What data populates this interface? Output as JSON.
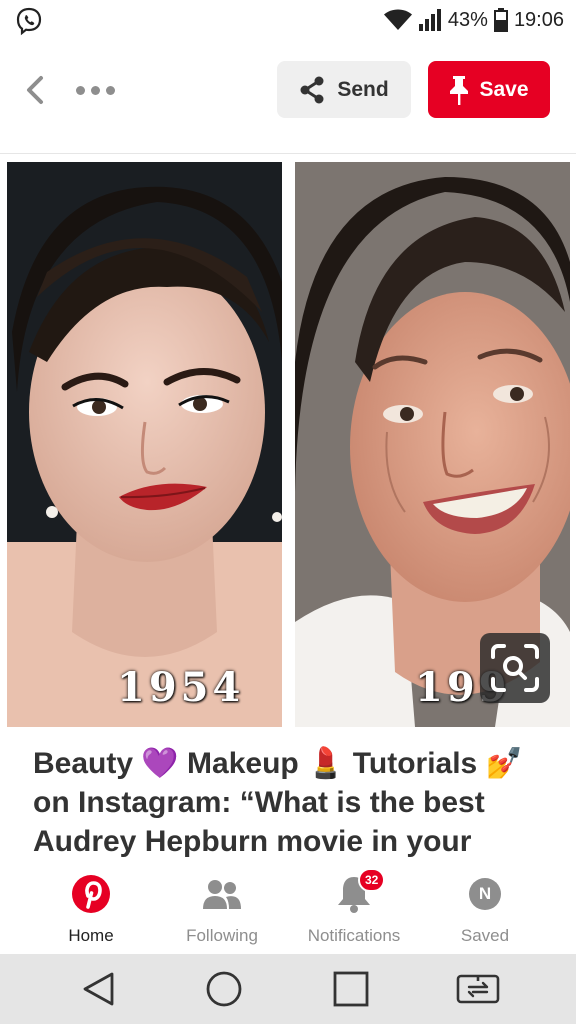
{
  "status_bar": {
    "battery_percent": "43%",
    "time": "19:06",
    "icons": [
      "viber-icon",
      "wifi-icon",
      "signal-icon",
      "battery-icon"
    ]
  },
  "actions": {
    "send_label": "Send",
    "save_label": "Save"
  },
  "pin": {
    "image_labels": [
      "1954",
      "199"
    ],
    "title": "Beauty 💜 Makeup 💄 Tutorials 💅 on Instagram: “What is the best Audrey Hepburn movie in your"
  },
  "bottom_nav": {
    "items": [
      {
        "label": "Home",
        "icon": "pinterest-logo-icon",
        "active": true
      },
      {
        "label": "Following",
        "icon": "people-icon"
      },
      {
        "label": "Notifications",
        "icon": "bell-icon",
        "badge": "32"
      },
      {
        "label": "Saved",
        "icon": "profile-avatar",
        "avatar_letter": "N"
      }
    ]
  },
  "colors": {
    "brand_red": "#e60023",
    "nav_gray": "#8e8e8e"
  }
}
